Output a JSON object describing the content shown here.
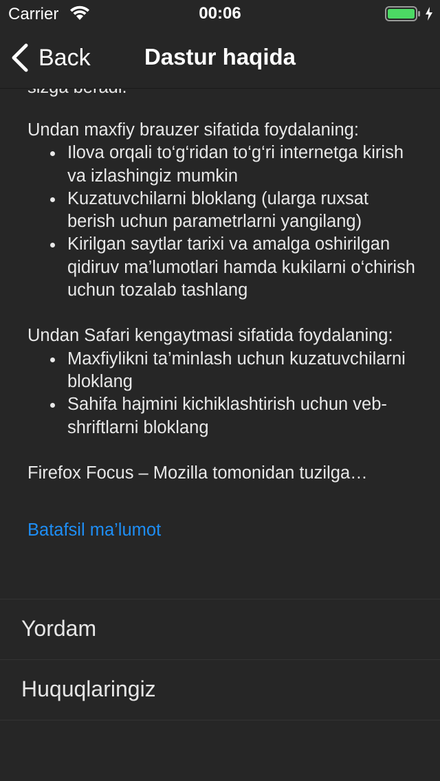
{
  "status_bar": {
    "carrier": "Carrier",
    "time": "00:06",
    "battery_color": "#4cd964"
  },
  "nav": {
    "back_label": "Back",
    "title": "Dastur haqida"
  },
  "content": {
    "clipped_line": "sizga beradi.",
    "section1_heading": "Undan maxfiy brauzer sifatida foydalaning:",
    "section1_items": [
      "Ilova orqali to‘g‘ridan to‘g‘ri internetga kirish va izlashingiz mumkin",
      "Kuzatuvchilarni bloklang (ularga ruxsat berish uchun parametrlarni yangilang)",
      "Kirilgan saytlar tarixi va amalga oshirilgan qidiruv ma’lumotlari hamda kukilarni o‘chirish uchun tozalab tashlang"
    ],
    "section2_heading": "Undan Safari kengaytmasi sifatida foydalaning:",
    "section2_items": [
      "Maxfiylikni ta’minlash uchun kuzatuvchilarni bloklang",
      "Sahifa hajmini kichiklashtirish uchun veb-shriftlarni bloklang"
    ],
    "footer_line": "Firefox Focus – Mozilla tomonidan tuzilga…",
    "more_link": "Batafsil ma’lumot",
    "link_color": "#1e8ef5"
  },
  "rows": [
    {
      "label": "Yordam"
    },
    {
      "label": "Huquqlaringiz"
    }
  ]
}
